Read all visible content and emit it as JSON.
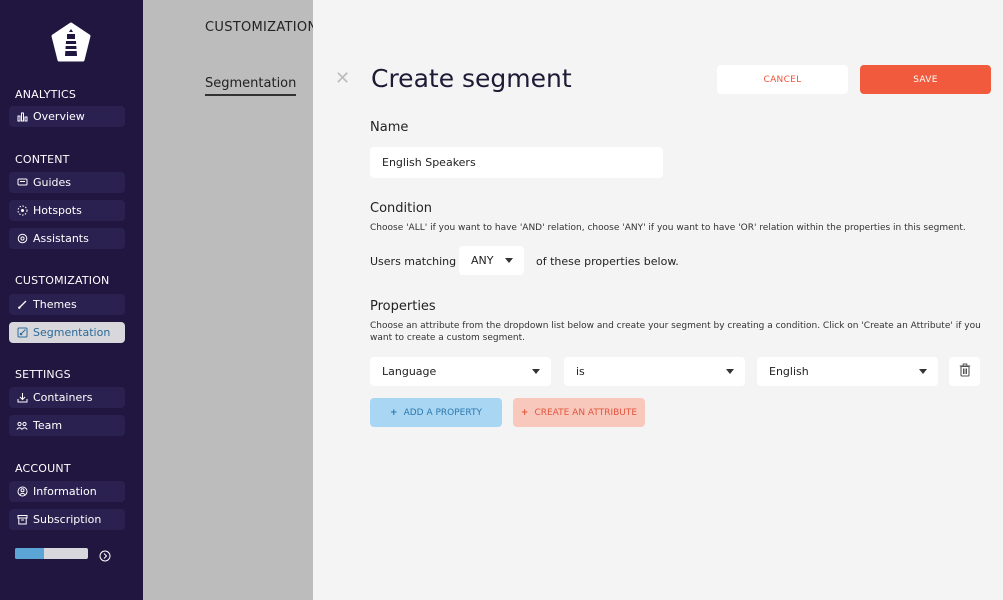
{
  "sidebar": {
    "sections": [
      {
        "title": "ANALYTICS",
        "items": [
          {
            "label": "Overview",
            "icon": "bar-chart-icon"
          }
        ]
      },
      {
        "title": "CONTENT",
        "items": [
          {
            "label": "Guides",
            "icon": "message-icon"
          },
          {
            "label": "Hotspots",
            "icon": "hotspot-icon"
          },
          {
            "label": "Assistants",
            "icon": "settings-icon"
          }
        ]
      },
      {
        "title": "CUSTOMIZATION",
        "items": [
          {
            "label": "Themes",
            "icon": "brush-icon"
          },
          {
            "label": "Segmentation",
            "icon": "segment-icon",
            "active": true
          }
        ]
      },
      {
        "title": "SETTINGS",
        "items": [
          {
            "label": "Containers",
            "icon": "download-icon"
          },
          {
            "label": "Team",
            "icon": "team-icon"
          }
        ]
      },
      {
        "title": "ACCOUNT",
        "items": [
          {
            "label": "Information",
            "icon": "user-circle-icon"
          },
          {
            "label": "Subscription",
            "icon": "archive-icon"
          }
        ]
      }
    ],
    "progress": 0.4
  },
  "background": {
    "breadcrumb": "CUSTOMIZATION |",
    "tab": "Segmentation"
  },
  "modal": {
    "title": "Create segment",
    "cancel_label": "CANCEL",
    "save_label": "SAVE",
    "name": {
      "label": "Name",
      "value": "English Speakers"
    },
    "condition": {
      "label": "Condition",
      "help": "Choose 'ALL' if you want to have 'AND' relation, choose 'ANY' if you want to have 'OR' relation within the properties in this segment.",
      "matching_label": "Users matching",
      "match_value": "ANY",
      "after_label": "of these properties below."
    },
    "properties": {
      "label": "Properties",
      "help": "Choose an attribute from the dropdown list below and create your segment by creating a condition. Click on 'Create an Attribute' if you want to create a custom segment.",
      "row": {
        "attribute": "Language",
        "operator": "is",
        "value": "English"
      },
      "add_property_label": "ADD A PROPERTY",
      "create_attribute_label": "CREATE AN ATTRIBUTE"
    }
  },
  "colors": {
    "sidebar_bg": "#201640",
    "accent_red": "#f25a3d",
    "accent_blue": "#5aa4d6"
  }
}
